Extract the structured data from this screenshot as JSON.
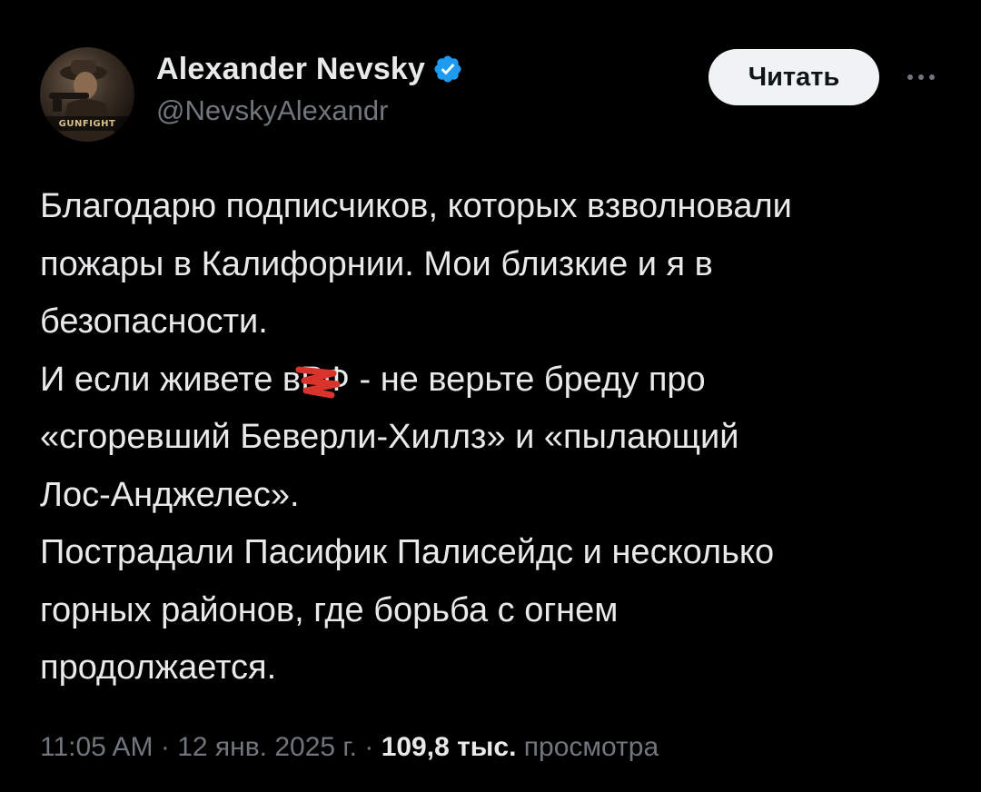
{
  "author": {
    "display_name": "Alexander Nevsky",
    "handle": "@NevskyAlexandr",
    "avatar_logo_text": "GUNFIGHT",
    "verified": true,
    "verified_color": "#1d9bf0"
  },
  "actions": {
    "follow_label": "Читать",
    "more_icon": "more-horizontal-icon"
  },
  "tweet": {
    "lines": [
      "Благодарю подписчиков, которых взволновали",
      "пожары в Калифорнии. Мои близкие и я в",
      "безопасности.",
      "И если живете в",
      "РФ",
      " - не верьте бреду про",
      "«сгоревший Беверли-Хиллз» и «пылающий",
      "Лос-Анджелес».",
      "Пострадали Пасифик Палисейдс и несколько",
      "горных районов, где борьба с огнем",
      "продолжается."
    ],
    "redaction_color": "#d9342b"
  },
  "meta": {
    "time": "11:05 AM",
    "separator": " · ",
    "date": "12 янв. 2025 г.",
    "views_count": "109,8 тыс.",
    "views_label": "просмотра"
  },
  "colors": {
    "background": "#000000",
    "text_primary": "#e7e9ea",
    "text_secondary": "#71767b",
    "button_bg": "#eff3f4"
  }
}
